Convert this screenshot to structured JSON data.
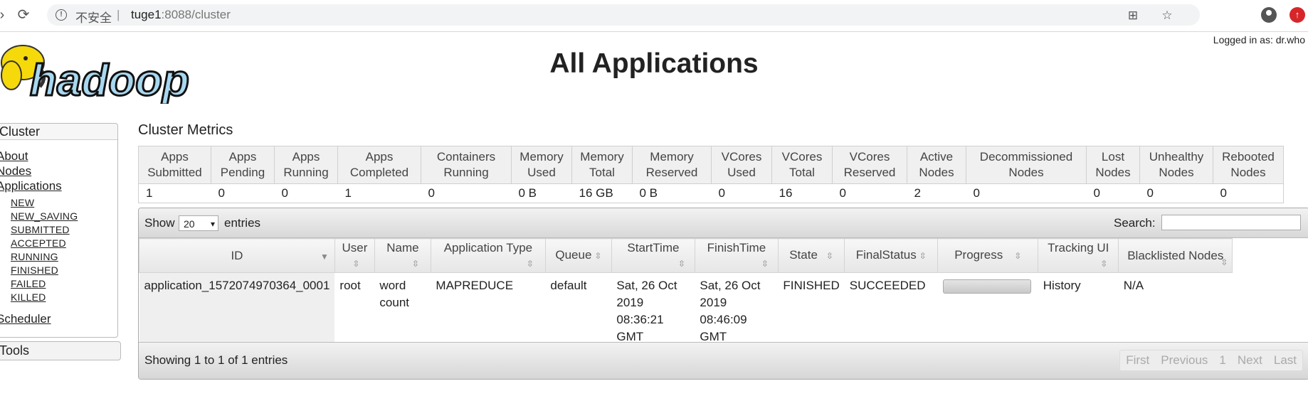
{
  "browser": {
    "security_text": "不安全",
    "url_host": "tuge1",
    "url_port": ":8088",
    "url_path": "/cluster"
  },
  "header": {
    "logged_in": "Logged in as: dr.who",
    "title": "All Applications",
    "logo_text": "hadoop"
  },
  "sidebar": {
    "cluster_label": "Cluster",
    "links": [
      "About",
      "Nodes",
      "Applications"
    ],
    "states": [
      "NEW",
      "NEW_SAVING",
      "SUBMITTED",
      "ACCEPTED",
      "RUNNING",
      "FINISHED",
      "FAILED",
      "KILLED"
    ],
    "scheduler": "Scheduler",
    "tools": "Tools"
  },
  "metrics": {
    "title": "Cluster Metrics",
    "headers": [
      [
        "Apps",
        "Submitted"
      ],
      [
        "Apps",
        "Pending"
      ],
      [
        "Apps",
        "Running"
      ],
      [
        "Apps",
        "Completed"
      ],
      [
        "Containers",
        "Running"
      ],
      [
        "Memory",
        "Used"
      ],
      [
        "Memory",
        "Total"
      ],
      [
        "Memory",
        "Reserved"
      ],
      [
        "VCores",
        "Used"
      ],
      [
        "VCores",
        "Total"
      ],
      [
        "VCores",
        "Reserved"
      ],
      [
        "Active",
        "Nodes"
      ],
      [
        "Decommissioned",
        "Nodes"
      ],
      [
        "Lost",
        "Nodes"
      ],
      [
        "Unhealthy",
        "Nodes"
      ],
      [
        "Rebooted",
        "Nodes"
      ]
    ],
    "values": [
      "1",
      "0",
      "0",
      "1",
      "0",
      "0 B",
      "16 GB",
      "0 B",
      "0",
      "16",
      "0",
      "2",
      "0",
      "0",
      "0",
      "0"
    ]
  },
  "apps_table": {
    "show_label": "Show",
    "entries_value": "20",
    "entries_label": "entries",
    "search_label": "Search:",
    "search_value": "",
    "columns": [
      "ID",
      "User",
      "Name",
      "Application Type",
      "Queue",
      "StartTime",
      "FinishTime",
      "State",
      "FinalStatus",
      "Progress",
      "Tracking UI",
      "Blacklisted Nodes"
    ],
    "rows": [
      {
        "id": "application_1572074970364_0001",
        "user": "root",
        "name": "word count",
        "type": "MAPREDUCE",
        "queue": "default",
        "start": "Sat, 26 Oct 2019 08:36:21 GMT",
        "finish": "Sat, 26 Oct 2019 08:46:09 GMT",
        "state": "FINISHED",
        "final_status": "SUCCEEDED",
        "progress": 0,
        "tracking": "History",
        "blacklisted": "N/A"
      }
    ],
    "info": "Showing 1 to 1 of 1 entries",
    "pager": [
      "First",
      "Previous",
      "1",
      "Next",
      "Last"
    ]
  }
}
